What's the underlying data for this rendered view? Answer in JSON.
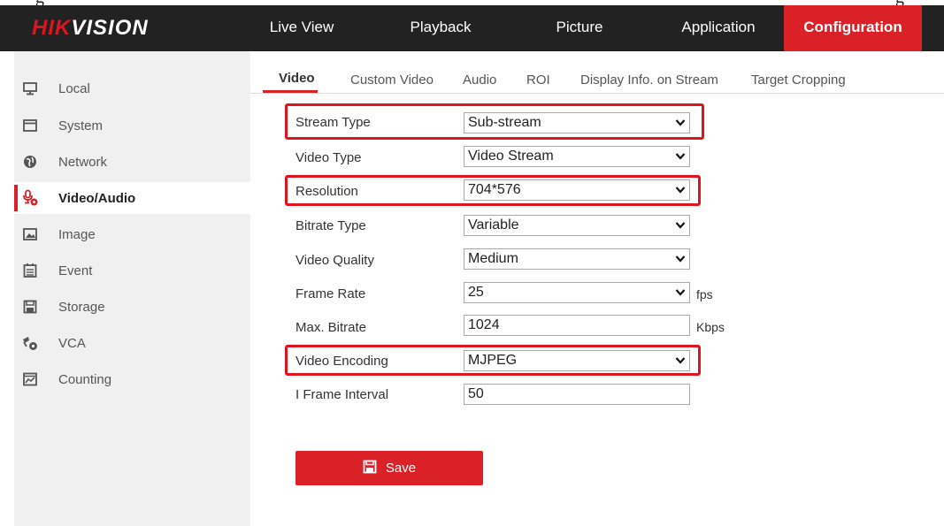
{
  "caption_fragment": [
    "g",
    "g"
  ],
  "brand": {
    "logo_red": "HIK",
    "logo_white": "VISION",
    "accent": "#da2128",
    "header_bg": "#222222"
  },
  "nav": {
    "items": [
      {
        "label": "Live View"
      },
      {
        "label": "Playback"
      },
      {
        "label": "Picture"
      },
      {
        "label": "Application"
      },
      {
        "label": "Configuration",
        "active": true
      }
    ]
  },
  "sidebar": {
    "items": [
      {
        "label": "Local",
        "icon": "monitor-icon"
      },
      {
        "label": "System",
        "icon": "window-icon"
      },
      {
        "label": "Network",
        "icon": "globe-icon"
      },
      {
        "label": "Video/Audio",
        "icon": "mic-gear-icon",
        "active": true
      },
      {
        "label": "Image",
        "icon": "image-icon"
      },
      {
        "label": "Event",
        "icon": "calendar-icon"
      },
      {
        "label": "Storage",
        "icon": "floppy-icon"
      },
      {
        "label": "VCA",
        "icon": "vca-icon"
      },
      {
        "label": "Counting",
        "icon": "counting-icon"
      }
    ]
  },
  "tabs": [
    {
      "label": "Video",
      "active": true
    },
    {
      "label": "Custom Video"
    },
    {
      "label": "Audio"
    },
    {
      "label": "ROI"
    },
    {
      "label": "Display Info. on Stream"
    },
    {
      "label": "Target Cropping"
    }
  ],
  "form": {
    "stream_type": {
      "label": "Stream Type",
      "value": "Sub-stream"
    },
    "video_type": {
      "label": "Video Type",
      "value": "Video Stream"
    },
    "resolution": {
      "label": "Resolution",
      "value": "704*576"
    },
    "bitrate_type": {
      "label": "Bitrate Type",
      "value": "Variable"
    },
    "video_quality": {
      "label": "Video Quality",
      "value": "Medium"
    },
    "frame_rate": {
      "label": "Frame Rate",
      "value": "25",
      "unit": "fps"
    },
    "max_bitrate": {
      "label": "Max. Bitrate",
      "value": "1024",
      "unit": "Kbps"
    },
    "video_encoding": {
      "label": "Video Encoding",
      "value": "MJPEG"
    },
    "i_frame_interval": {
      "label": "I Frame Interval",
      "value": "50"
    }
  },
  "save_label": "Save"
}
